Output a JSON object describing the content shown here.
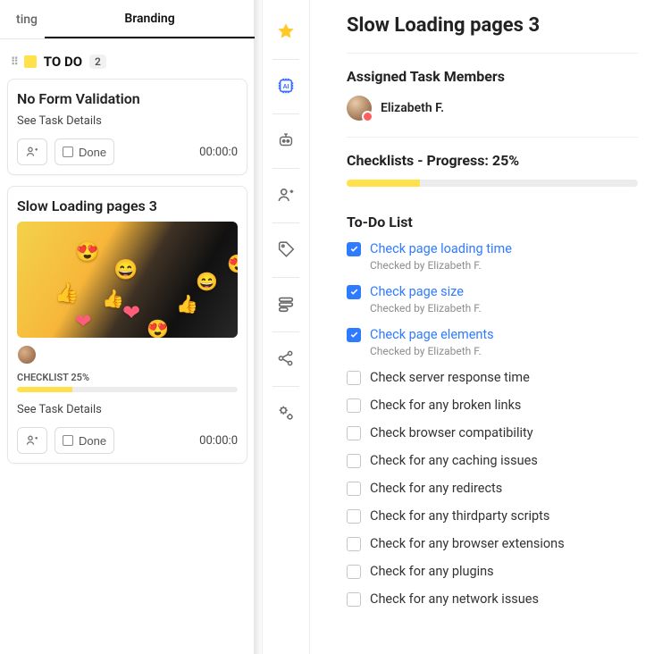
{
  "board": {
    "tabs": {
      "partial_left": "ting",
      "active": "Branding"
    },
    "column": {
      "name": "TO DO",
      "count": "2"
    },
    "card1": {
      "title": "No Form Validation",
      "see_details": "See Task Details",
      "done_label": "Done",
      "timer": "00:00:0"
    },
    "card2": {
      "title": "Slow Loading pages 3",
      "checklist_label": "CHECKLIST 25%",
      "checklist_pct": 25,
      "see_details": "See Task Details",
      "done_label": "Done",
      "timer": "00:00:0"
    }
  },
  "detail": {
    "title": "Slow Loading pages 3",
    "members_heading": "Assigned Task Members",
    "member_name": "Elizabeth F.",
    "checklist_heading": "Checklists - Progress: 25%",
    "checklist_pct": 25,
    "todo_heading": "To-Do List",
    "checked_by_prefix": "Checked by",
    "checked_by_name": "Elizabeth F.",
    "items": [
      {
        "label": "Check page loading time",
        "done": true
      },
      {
        "label": "Check page size",
        "done": true
      },
      {
        "label": "Check page elements",
        "done": true
      },
      {
        "label": "Check server response time",
        "done": false
      },
      {
        "label": "Check for any broken links",
        "done": false
      },
      {
        "label": "Check browser compatibility",
        "done": false
      },
      {
        "label": "Check for any caching issues",
        "done": false
      },
      {
        "label": "Check for any redirects",
        "done": false
      },
      {
        "label": "Check for any thirdparty scripts",
        "done": false
      },
      {
        "label": "Check for any browser extensions",
        "done": false
      },
      {
        "label": "Check for any plugins",
        "done": false
      },
      {
        "label": "Check for any network issues",
        "done": false
      }
    ]
  },
  "rail_icons": [
    "star",
    "ai",
    "robot",
    "add-user",
    "tag",
    "queue",
    "share",
    "settings"
  ],
  "colors": {
    "accent_yellow": "#ffe24b",
    "link_blue": "#2f7bff"
  }
}
